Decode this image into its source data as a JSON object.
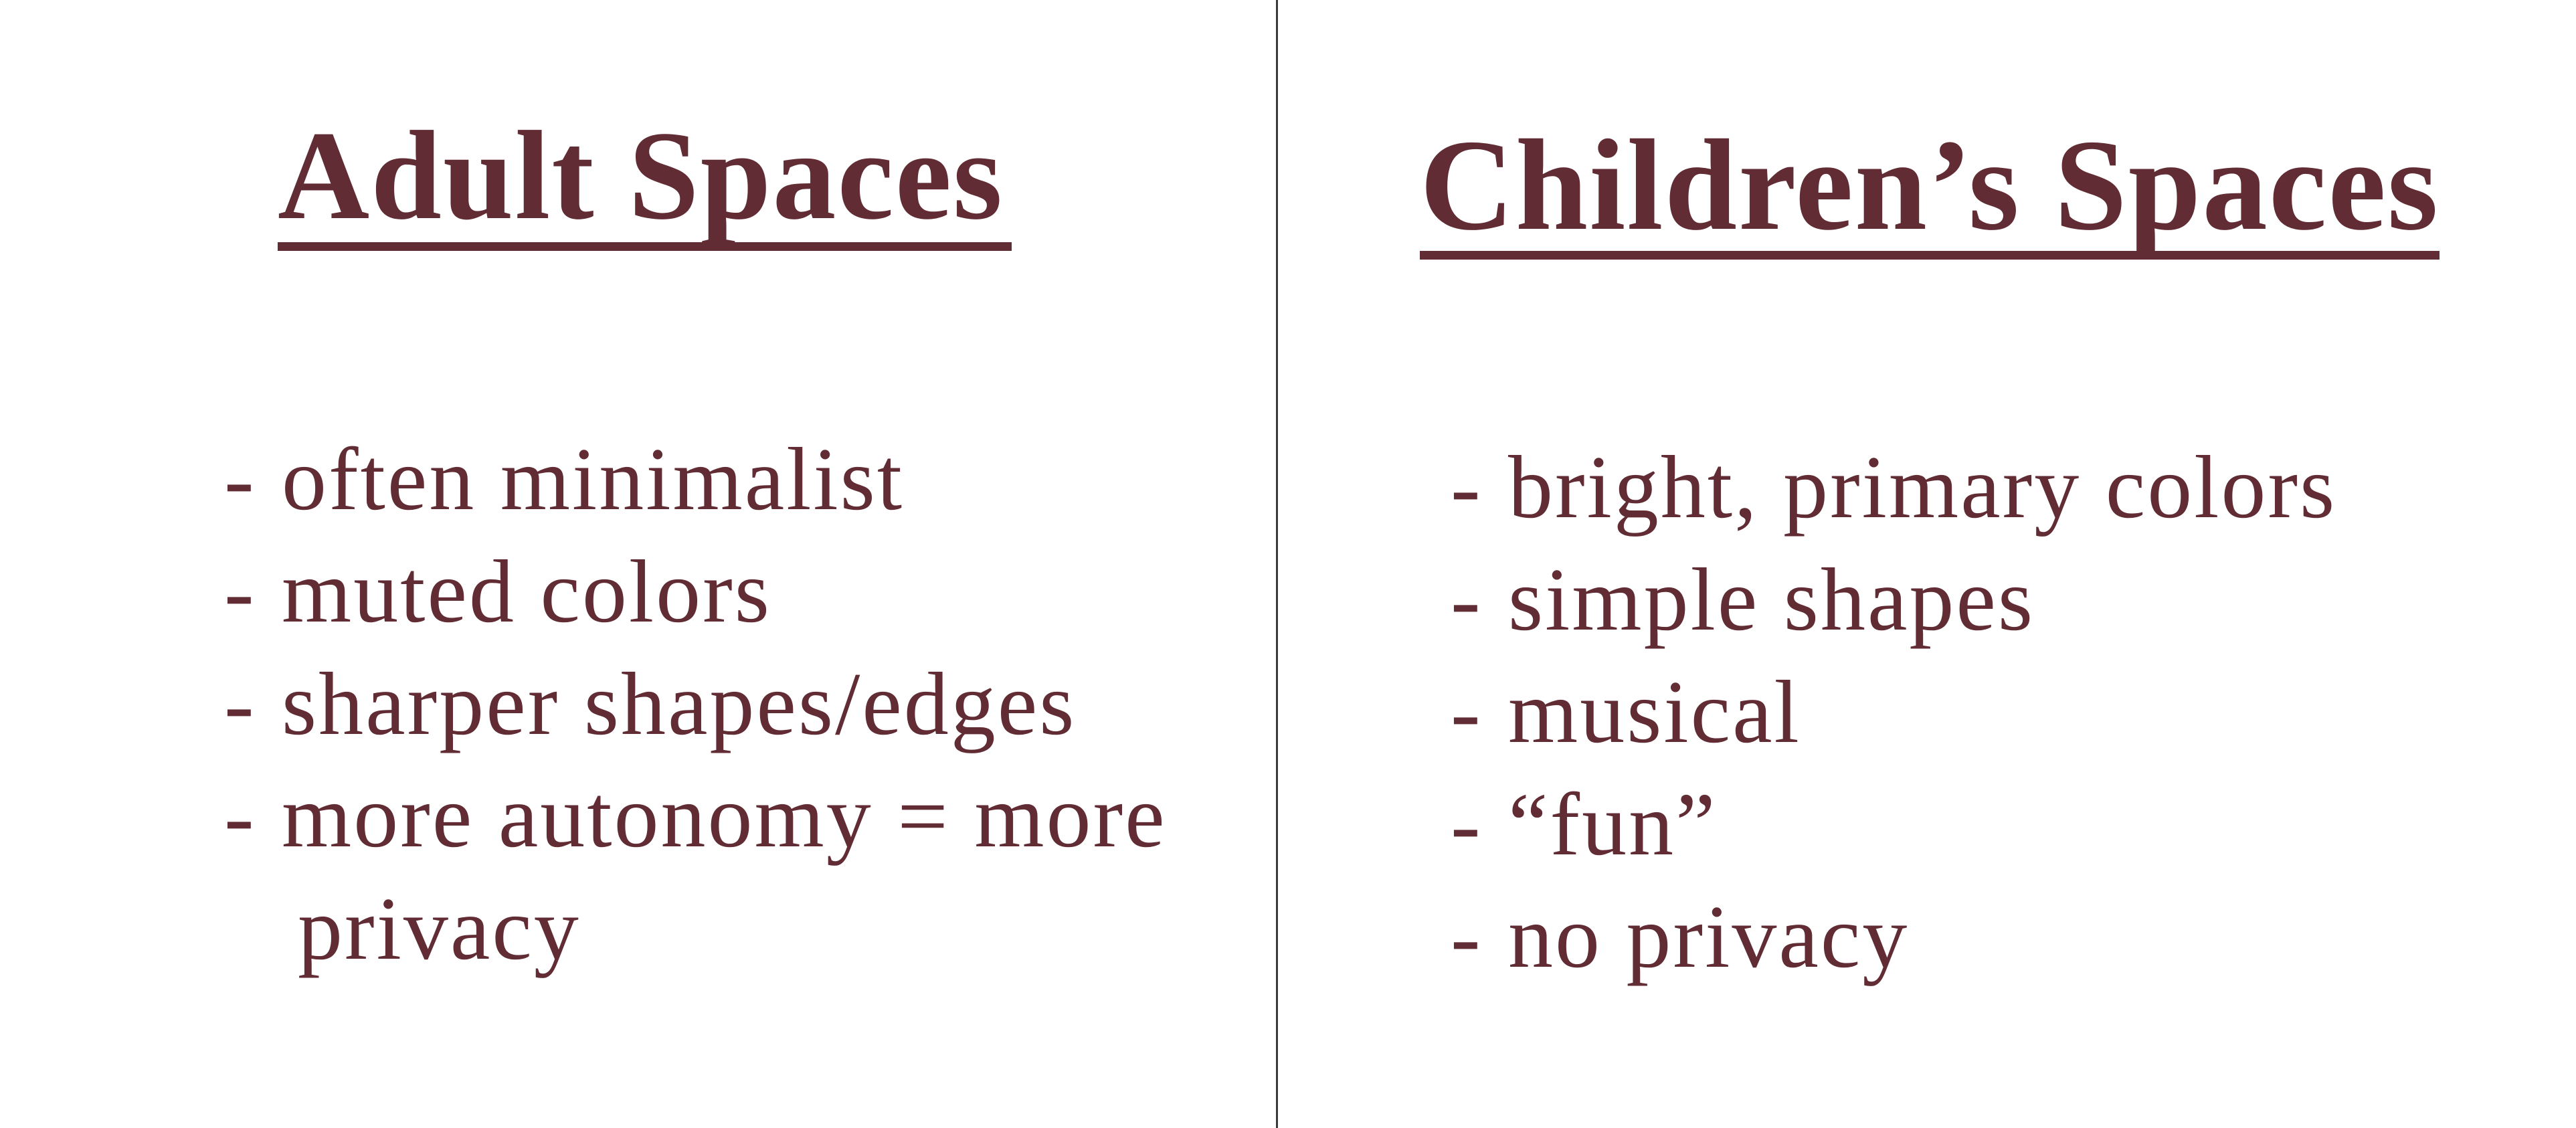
{
  "left": {
    "heading": "Adult Spaces",
    "items": [
      "often minimalist",
      "muted colors",
      "sharper shapes/edges",
      "more autonomy = more"
    ],
    "continuation": "privacy"
  },
  "right": {
    "heading": "Children’s Spaces",
    "items": [
      "bright, primary colors",
      "simple shapes",
      "musical",
      "“fun”",
      "no privacy"
    ]
  },
  "bullet": "-",
  "colors": {
    "text": "#612c34",
    "divider": "#3a3a3a",
    "background": "#ffffff"
  }
}
